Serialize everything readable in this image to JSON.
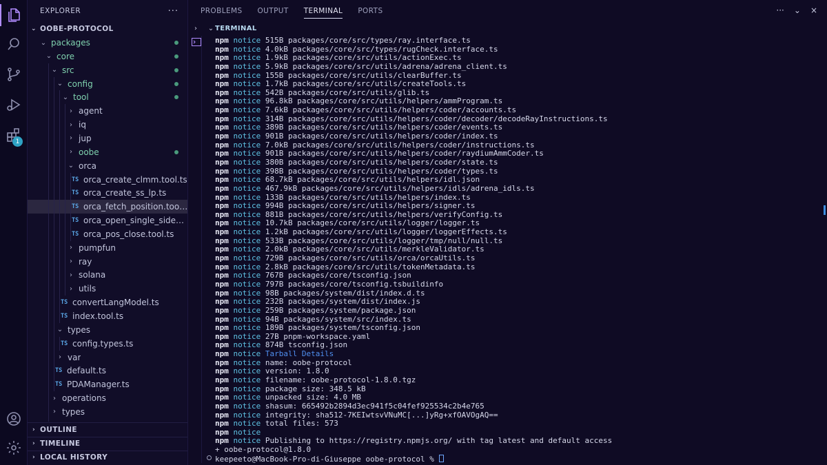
{
  "sidebar": {
    "title": "EXPLORER",
    "more": "···",
    "project": "OOBE-PROTOCOL",
    "sections": {
      "outline": "OUTLINE",
      "timeline": "TIMELINE",
      "local_history": "LOCAL HISTORY"
    },
    "tree": [
      {
        "label": "packages",
        "type": "folder",
        "open": true,
        "level": 1,
        "dot": true
      },
      {
        "label": "core",
        "type": "folder",
        "open": true,
        "level": 2,
        "dot": true
      },
      {
        "label": "src",
        "type": "folder",
        "open": true,
        "level": 3,
        "dot": true
      },
      {
        "label": "config",
        "type": "folder",
        "open": true,
        "level": 4,
        "dot": true
      },
      {
        "label": "tool",
        "type": "folder",
        "open": true,
        "level": 5,
        "dot": true
      },
      {
        "label": "agent",
        "type": "folder",
        "open": false,
        "level": 6
      },
      {
        "label": "iq",
        "type": "folder",
        "open": false,
        "level": 6
      },
      {
        "label": "jup",
        "type": "folder",
        "open": false,
        "level": 6
      },
      {
        "label": "oobe",
        "type": "folder",
        "open": false,
        "level": 6,
        "dot": true
      },
      {
        "label": "orca",
        "type": "folder",
        "open": true,
        "level": 6
      },
      {
        "label": "orca_create_clmm.tool.ts",
        "type": "file",
        "level": 7
      },
      {
        "label": "orca_create_ss_lp.ts",
        "type": "file",
        "level": 7
      },
      {
        "label": "orca_fetch_position.tool.ts",
        "type": "file",
        "level": 7,
        "selected": true
      },
      {
        "label": "orca_open_single_side_po...",
        "type": "file",
        "level": 7
      },
      {
        "label": "orca_pos_close.tool.ts",
        "type": "file",
        "level": 7
      },
      {
        "label": "pumpfun",
        "type": "folder",
        "open": false,
        "level": 6
      },
      {
        "label": "ray",
        "type": "folder",
        "open": false,
        "level": 6
      },
      {
        "label": "solana",
        "type": "folder",
        "open": false,
        "level": 6
      },
      {
        "label": "utils",
        "type": "folder",
        "open": false,
        "level": 6
      },
      {
        "label": "convertLangModel.ts",
        "type": "file",
        "level": 5
      },
      {
        "label": "index.tool.ts",
        "type": "file",
        "level": 5
      },
      {
        "label": "types",
        "type": "folder",
        "open": true,
        "level": 4
      },
      {
        "label": "config.types.ts",
        "type": "file",
        "level": 5
      },
      {
        "label": "var",
        "type": "folder",
        "open": false,
        "level": 4
      },
      {
        "label": "default.ts",
        "type": "file",
        "level": 4
      },
      {
        "label": "PDAManager.ts",
        "type": "file",
        "level": 4
      },
      {
        "label": "operations",
        "type": "folder",
        "open": false,
        "level": 3
      },
      {
        "label": "types",
        "type": "folder",
        "open": false,
        "level": 3
      },
      {
        "label": "utils",
        "type": "folder",
        "open": false,
        "level": 3
      }
    ]
  },
  "activity": {
    "extensions_badge": "1"
  },
  "panel": {
    "tabs": [
      "PROBLEMS",
      "OUTPUT",
      "TERMINAL",
      "PORTS"
    ],
    "active_tab": "TERMINAL",
    "terminal_title": "TERMINAL",
    "actions": [
      "···",
      "⌄",
      "×"
    ]
  },
  "terminal": {
    "prefix": "npm",
    "level": "notice",
    "lines": [
      "515B packages/core/src/types/ray.interface.ts",
      "4.0kB packages/core/src/types/rugCheck.interface.ts",
      "1.9kB packages/core/src/utils/actionExec.ts",
      "5.9kB packages/core/src/utils/adrena/adrena_client.ts",
      "155B packages/core/src/utils/clearBuffer.ts",
      "1.7kB packages/core/src/utils/createTools.ts",
      "542B packages/core/src/utils/glib.ts",
      "96.8kB packages/core/src/utils/helpers/ammProgram.ts",
      "7.6kB packages/core/src/utils/helpers/coder/accounts.ts",
      "314B packages/core/src/utils/helpers/coder/decoder/decodeRayInstructions.ts",
      "389B packages/core/src/utils/helpers/coder/events.ts",
      "901B packages/core/src/utils/helpers/coder/index.ts",
      "7.0kB packages/core/src/utils/helpers/coder/instructions.ts",
      "901B packages/core/src/utils/helpers/coder/raydiumAmmCoder.ts",
      "380B packages/core/src/utils/helpers/coder/state.ts",
      "398B packages/core/src/utils/helpers/coder/types.ts",
      "68.7kB packages/core/src/utils/helpers/idl.json",
      "467.9kB packages/core/src/utils/helpers/idls/adrena_idls.ts",
      "133B packages/core/src/utils/helpers/index.ts",
      "994B packages/core/src/utils/helpers/signer.ts",
      "881B packages/core/src/utils/helpers/verifyConfig.ts",
      "10.7kB packages/core/src/utils/logger/logger.ts",
      "1.2kB packages/core/src/utils/logger/loggerEffects.ts",
      "533B packages/core/src/utils/logger/tmp/null/null.ts",
      "2.0kB packages/core/src/utils/merkleValidator.ts",
      "729B packages/core/src/utils/orca/orcaUtils.ts",
      "2.8kB packages/core/src/utils/tokenMetadata.ts",
      "767B packages/core/tsconfig.json",
      "797B packages/core/tsconfig.tsbuildinfo",
      "98B packages/system/dist/index.d.ts",
      "232B packages/system/dist/index.js",
      "259B packages/system/package.json",
      "94B packages/system/src/index.ts",
      "189B packages/system/tsconfig.json",
      "27B pnpm-workspace.yaml",
      "874B tsconfig.json",
      "§Tarball Details",
      "name: oobe-protocol",
      "version: 1.8.0",
      "filename: oobe-protocol-1.8.0.tgz",
      "package size: 348.5 kB",
      "unpacked size: 4.0 MB",
      "shasum: 665492b2894d3ec941f5c04fef925534c2b4e765",
      "integrity: sha512-7KEIwtsvVNuMC[...]yRg+xfOAVOgAQ==",
      "total files: 573",
      "",
      "Publishing to https://registry.npmjs.org/ with tag latest and default access"
    ],
    "published": "+ oobe-protocol@1.8.0",
    "prompt": "keepeeto@MacBook-Pro-di-Giuseppe oobe-protocol % "
  }
}
